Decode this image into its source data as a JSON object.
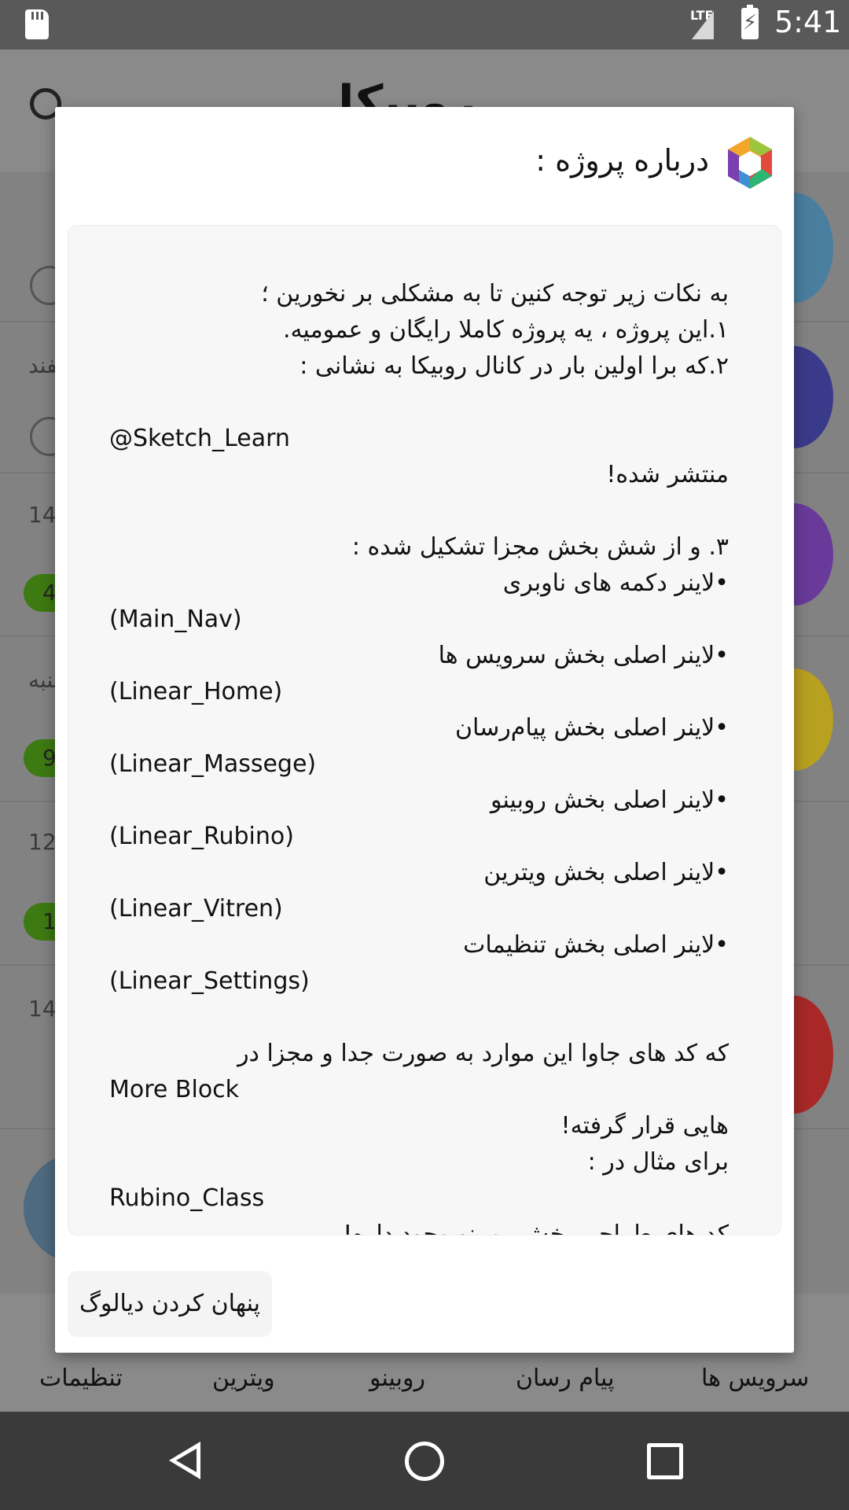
{
  "status_bar": {
    "network": "LTE",
    "time": "5:41"
  },
  "app": {
    "title": "روبیکا",
    "list_numbers": [
      "14",
      "14",
      "12",
      "14"
    ],
    "list_snippets": [
      "ففند",
      "شنبه"
    ],
    "badges": [
      "4",
      "9",
      "1"
    ]
  },
  "bottom_nav": {
    "items": [
      {
        "label": "تنظیمات"
      },
      {
        "label": "ویترین"
      },
      {
        "label": "روبینو"
      },
      {
        "label": "پیام رسان"
      },
      {
        "label": "سرویس ها"
      }
    ]
  },
  "dialog": {
    "title": "درباره پروژه :",
    "lines": [
      {
        "text": "به نکات زیر توجه کنین تا به مشکلی بر نخورین ؛",
        "dir": "rtl"
      },
      {
        "text": "۱.این پروژه ، یه پروژه کاملا رایگان و عمومیه.",
        "dir": "rtl"
      },
      {
        "text": "۲.که برا اولین بار در کانال روبیکا به نشانی :",
        "dir": "rtl"
      },
      {
        "text": "",
        "dir": "rtl"
      },
      {
        "text": "@Sketch_Learn",
        "dir": "ltr"
      },
      {
        "text": "منتشر شده!",
        "dir": "rtl"
      },
      {
        "text": "",
        "dir": "rtl"
      },
      {
        "text": "۳. و از شش بخش مجزا تشکیل شده :",
        "dir": "rtl"
      },
      {
        "text": "•لاینر دکمه های ناوبری",
        "dir": "rtl"
      },
      {
        "text": "(Main_Nav)",
        "dir": "ltr"
      },
      {
        "text": "•لاینر اصلی بخش سرویس ها",
        "dir": "rtl"
      },
      {
        "text": "(Linear_Home)",
        "dir": "ltr"
      },
      {
        "text": "•لاینر اصلی بخش پیام‌رسان",
        "dir": "rtl"
      },
      {
        "text": "(Linear_Massege)",
        "dir": "ltr"
      },
      {
        "text": "•لاینر اصلی بخش روبینو",
        "dir": "rtl"
      },
      {
        "text": "(Linear_Rubino)",
        "dir": "ltr"
      },
      {
        "text": "•لاینر اصلی بخش ویترین",
        "dir": "rtl"
      },
      {
        "text": "(Linear_Vitren)",
        "dir": "ltr"
      },
      {
        "text": "•لاینر اصلی بخش تنظیمات",
        "dir": "rtl"
      },
      {
        "text": "(Linear_Settings)",
        "dir": "ltr"
      },
      {
        "text": "",
        "dir": "rtl"
      },
      {
        "text": "که کد های جاوا این موارد به صورت جدا و مجزا در",
        "dir": "rtl"
      },
      {
        "text": "More Block",
        "dir": "ltr"
      },
      {
        "text": "هایی قرار گرفته!",
        "dir": "rtl"
      },
      {
        "text": "برای مثال در :",
        "dir": "rtl"
      },
      {
        "text": "Rubino_Class",
        "dir": "ltr"
      },
      {
        "text": "کد های طراحی بخش روبینو وجود داره!",
        "dir": "rtl"
      }
    ],
    "hide_button_label": "پنهان کردن دیالوگ"
  }
}
